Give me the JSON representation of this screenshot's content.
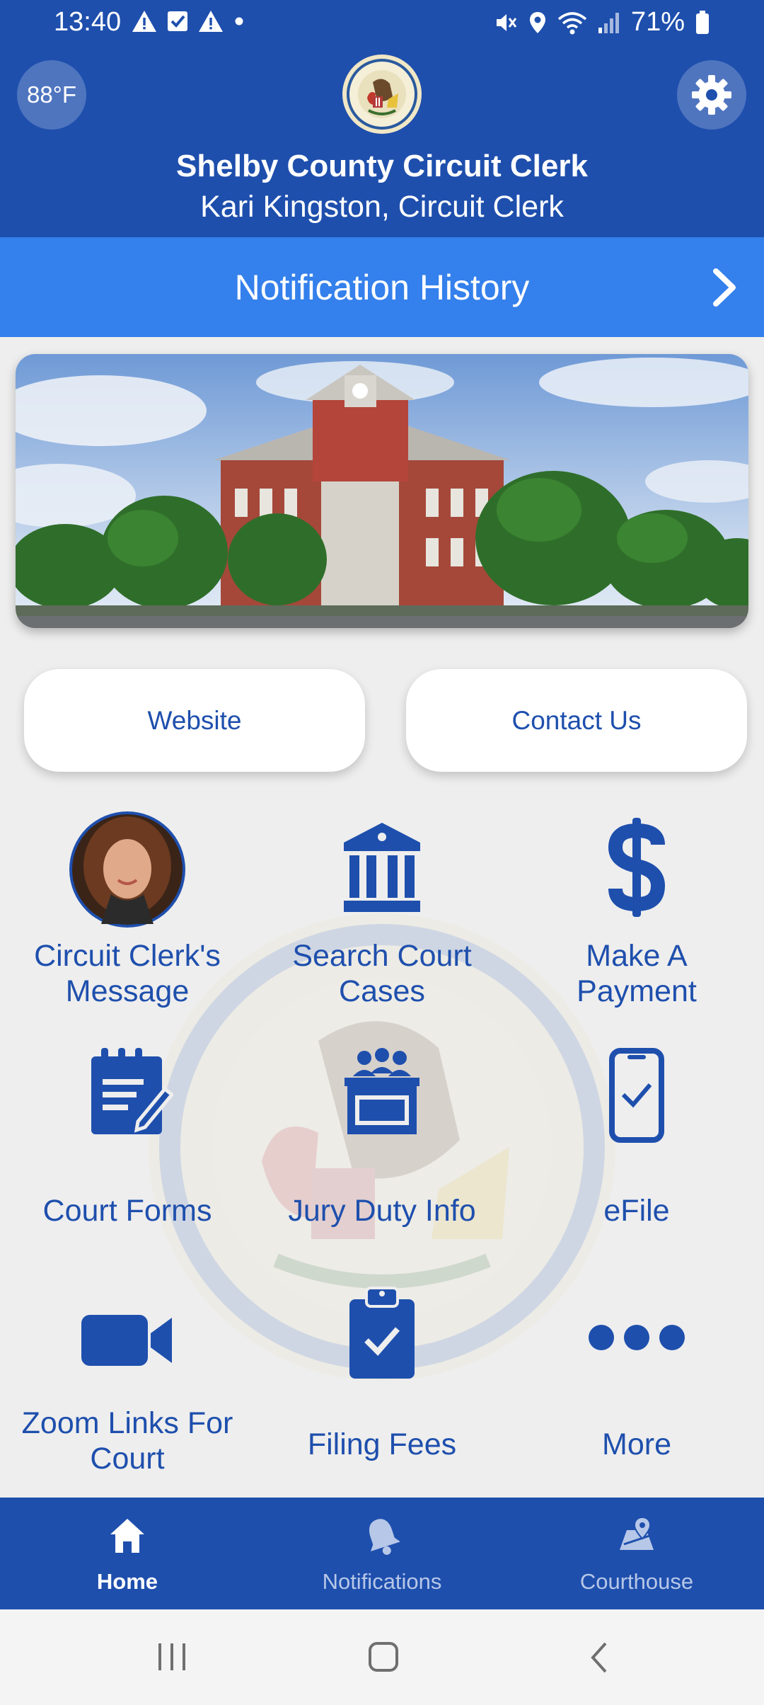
{
  "status_bar": {
    "time": "13:40",
    "battery": "71%"
  },
  "header": {
    "temperature": "88°F",
    "title": "Shelby County Circuit Clerk",
    "subtitle": "Kari Kingston, Circuit Clerk"
  },
  "notification_bar": {
    "label": "Notification History"
  },
  "quick_links": {
    "website": "Website",
    "contact": "Contact Us"
  },
  "tiles": [
    {
      "label_line1": "Circuit Clerk's",
      "label_line2": "Message",
      "icon": "clerk-photo"
    },
    {
      "label_line1": "Search Court",
      "label_line2": "Cases",
      "icon": "courthouse-icon"
    },
    {
      "label_line1": "Make A",
      "label_line2": "Payment",
      "icon": "dollar-icon"
    },
    {
      "label_line1": "Court Forms",
      "icon": "form-icon"
    },
    {
      "label_line1": "Jury Duty Info",
      "icon": "jury-icon"
    },
    {
      "label_line1": "eFile",
      "icon": "phone-check-icon"
    },
    {
      "label_line1": "Zoom Links For",
      "label_line2": "Court",
      "icon": "video-icon"
    },
    {
      "label_line1": "Filing Fees",
      "icon": "clipboard-check-icon"
    },
    {
      "label_line1": "More",
      "icon": "more-icon"
    }
  ],
  "bottom_nav": {
    "items": [
      {
        "label": "Home",
        "icon": "home-icon",
        "active": true
      },
      {
        "label": "Notifications",
        "icon": "bell-icon",
        "active": false
      },
      {
        "label": "Courthouse",
        "icon": "map-pin-icon",
        "active": false
      }
    ]
  },
  "colors": {
    "brand_blue": "#1e4fad",
    "notification_blue": "#3480ec",
    "background": "#eeeeee",
    "nav_inactive": "#b7c7e8"
  }
}
